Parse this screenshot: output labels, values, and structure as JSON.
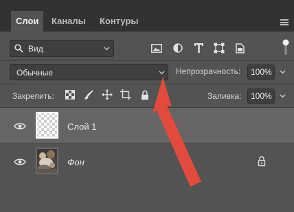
{
  "tabs": [
    {
      "label": "Слои",
      "active": true
    },
    {
      "label": "Каналы",
      "active": false
    },
    {
      "label": "Контуры",
      "active": false
    }
  ],
  "filter": {
    "kind_label": "Вид",
    "icons": [
      "image-filter-icon",
      "adjustment-filter-icon",
      "type-filter-icon",
      "shape-filter-icon",
      "smart-object-filter-icon"
    ]
  },
  "blend": {
    "mode": "Обычные",
    "opacity_label": "Непрозрачность:",
    "opacity_value": "100%"
  },
  "lock": {
    "label": "Закрепить:",
    "icons": [
      "lock-transparent-pixels-icon",
      "lock-image-pixels-icon",
      "lock-position-icon",
      "lock-artboard-icon",
      "lock-all-icon"
    ],
    "fill_label": "Заливка:",
    "fill_value": "100%"
  },
  "layers": [
    {
      "name": "Слой 1",
      "selected": true,
      "visible": true,
      "locked": false
    },
    {
      "name": "Фон",
      "selected": false,
      "visible": true,
      "locked": true
    }
  ],
  "colors": {
    "panel": "#535353",
    "tabbar": "#323232",
    "selected_layer": "#656565",
    "arrow": "#e34a3e"
  }
}
